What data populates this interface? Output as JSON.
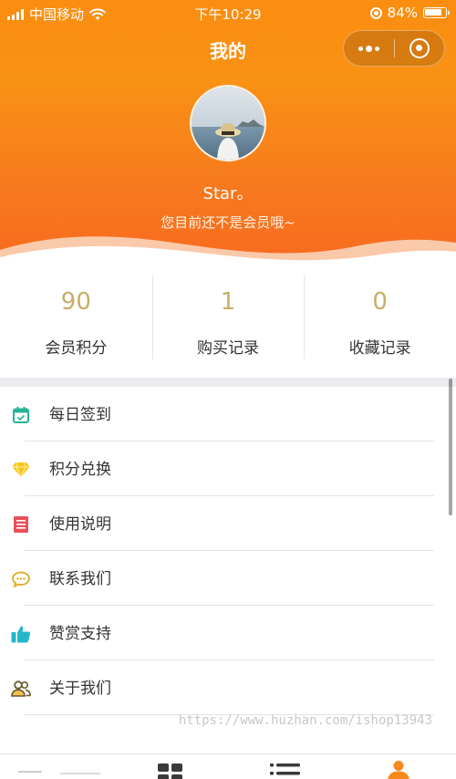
{
  "status_bar": {
    "carrier": "中国移动",
    "time": "下午10:29",
    "battery": "84%",
    "battery_level": 0.84
  },
  "nav": {
    "title": "我的",
    "more_icon": "more-dots-icon",
    "close_icon": "target-circle-icon"
  },
  "profile": {
    "username": "Star。",
    "member_note": "您目前还不是会员哦~"
  },
  "stats": [
    {
      "value": "90",
      "label": "会员积分"
    },
    {
      "value": "1",
      "label": "购买记录"
    },
    {
      "value": "0",
      "label": "收藏记录"
    }
  ],
  "menu": [
    {
      "label": "每日签到",
      "icon": "calendar-check-icon",
      "color": "#2bb39a"
    },
    {
      "label": "积分兑换",
      "icon": "diamond-icon",
      "color": "#f5c518"
    },
    {
      "label": "使用说明",
      "icon": "document-icon",
      "color": "#e8505b"
    },
    {
      "label": "联系我们",
      "icon": "chat-bubble-icon",
      "color": "#e0a826"
    },
    {
      "label": "赞赏支持",
      "icon": "thumbs-up-icon",
      "color": "#25b7c9"
    },
    {
      "label": "关于我们",
      "icon": "people-icon",
      "color": "#6b5a2e"
    }
  ],
  "watermark": "https://www.huzhan.com/ishop13943",
  "tabbar": {
    "tabs": [
      {
        "icon": "home-icon"
      },
      {
        "icon": "grid-icon"
      },
      {
        "icon": "list-icon"
      },
      {
        "icon": "user-icon",
        "active_color": "#f68a1e"
      }
    ]
  },
  "colors": {
    "brand_orange": "#f98a17",
    "stat_gold": "#c9ad6a"
  }
}
